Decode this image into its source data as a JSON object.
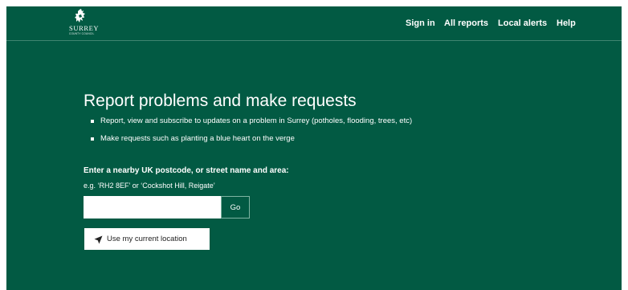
{
  "header": {
    "logo_name": "SURREY",
    "logo_sub": "COUNTY COUNCIL",
    "logo_icon": "stag-crest-icon",
    "nav": {
      "sign_in": "Sign in",
      "all_reports": "All reports",
      "local_alerts": "Local alerts",
      "help": "Help"
    }
  },
  "hero": {
    "title": "Report problems and make requests",
    "bullets": [
      "Report, view and subscribe to updates on a problem in Surrey (potholes, flooding, trees, etc)",
      "Make requests such as planting a blue heart on the verge"
    ]
  },
  "search": {
    "label": "Enter a nearby UK postcode, or street name and area:",
    "hint": "e.g. ‘RH2 8EF’ or ‘Cockshot Hill, Reigate’",
    "value": "",
    "go_label": "Go",
    "location_label": "Use my current location",
    "location_icon": "location-arrow-icon"
  },
  "colors": {
    "background": "#025a43",
    "text": "#ffffff",
    "button_text": "#222222"
  }
}
